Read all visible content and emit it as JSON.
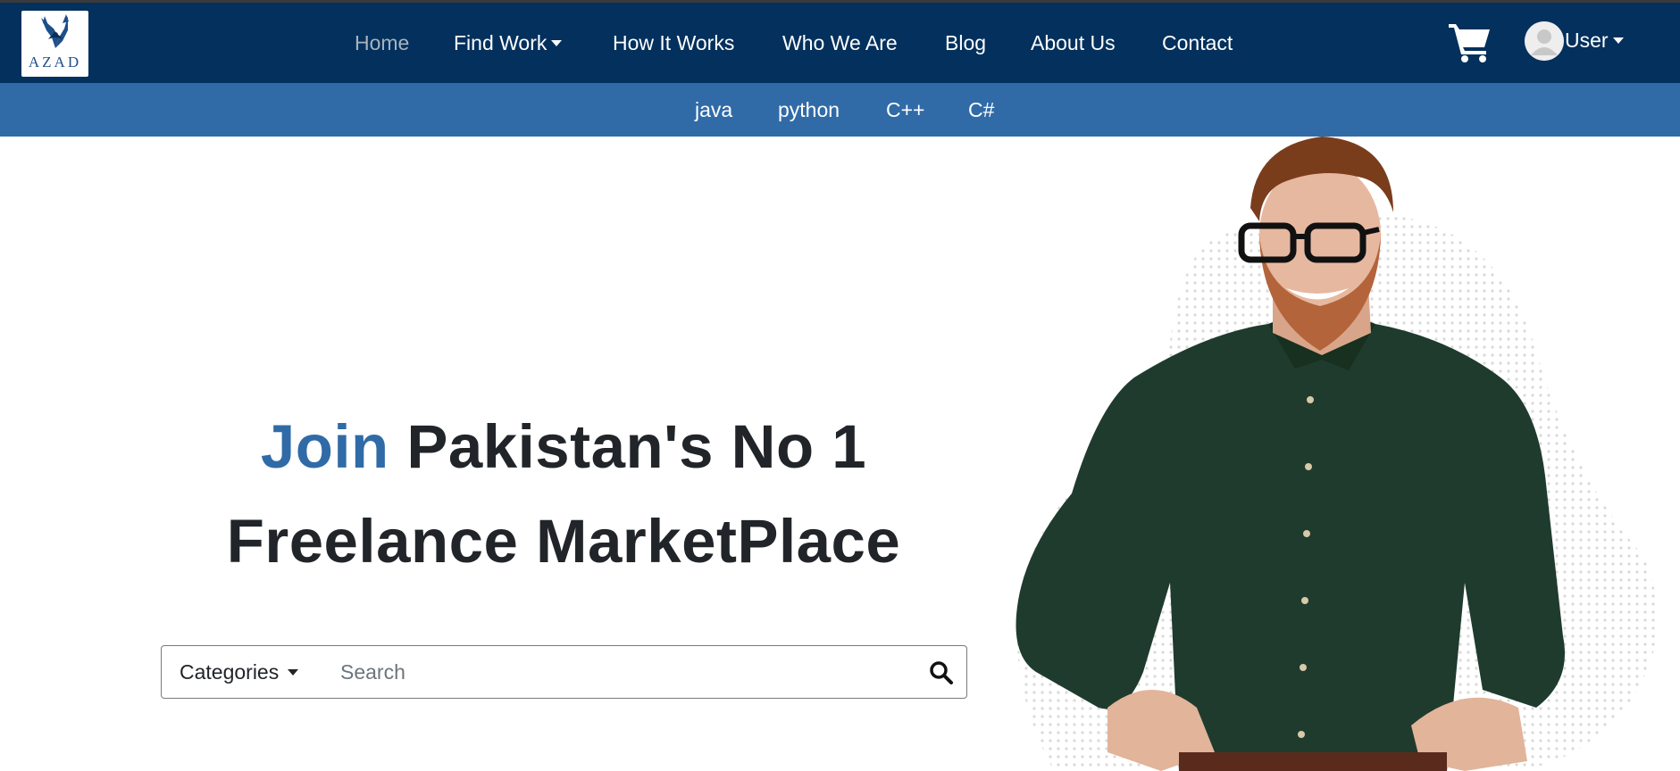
{
  "brand": {
    "logo_text": "AZAD",
    "nav_bg": "#03305c",
    "subnav_bg": "#306ba7",
    "accent": "#306ba7"
  },
  "nav": {
    "items": [
      {
        "label": "Home",
        "active": true
      },
      {
        "label": "Find Work",
        "dropdown": true
      },
      {
        "label": "How It Works"
      },
      {
        "label": "Who We Are"
      },
      {
        "label": "Blog"
      },
      {
        "label": "About Us"
      },
      {
        "label": "Contact"
      }
    ],
    "cart_icon": "shopping-cart-icon",
    "user_label": "User"
  },
  "subnav": {
    "items": [
      "java",
      "python",
      "C++",
      "C#"
    ]
  },
  "hero": {
    "title_accent": "Join",
    "title_rest": "Pakistan's No 1",
    "title_line2": "Freelance MarketPlace"
  },
  "search": {
    "category_label": "Categories",
    "placeholder": "Search",
    "value": "",
    "search_icon": "magnifier-icon"
  }
}
